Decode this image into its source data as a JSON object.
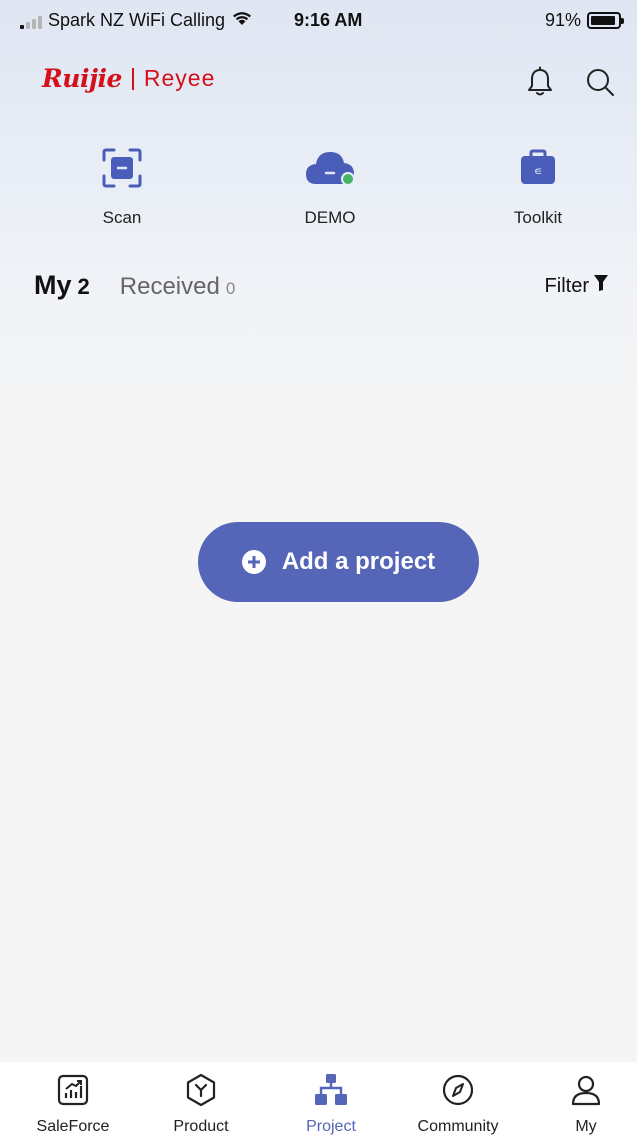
{
  "status_bar": {
    "carrier": "Spark NZ WiFi Calling",
    "time": "9:16 AM",
    "battery": "91%",
    "battery_level": 0.91
  },
  "header": {
    "brand": "Ruijie",
    "sub_brand": "Reyee",
    "brand_color": "#d4101a"
  },
  "quick_actions": [
    {
      "label": "Scan",
      "icon": "scan-icon"
    },
    {
      "label": "DEMO",
      "icon": "cloud-icon"
    },
    {
      "label": "Toolkit",
      "icon": "toolkit-icon"
    }
  ],
  "tabs": {
    "my": {
      "label": "My",
      "count": "2"
    },
    "received": {
      "label": "Received",
      "count": "0"
    }
  },
  "filter_label": "Filter",
  "add_project_label": "Add a project",
  "accent_color": "#5565b8",
  "bottom_nav": [
    {
      "label": "SaleForce",
      "icon": "chart-icon",
      "active": false
    },
    {
      "label": "Product",
      "icon": "product-icon",
      "active": false
    },
    {
      "label": "Project",
      "icon": "network-icon",
      "active": true
    },
    {
      "label": "Community",
      "icon": "compass-icon",
      "active": false
    },
    {
      "label": "My",
      "icon": "user-icon",
      "active": false
    }
  ]
}
